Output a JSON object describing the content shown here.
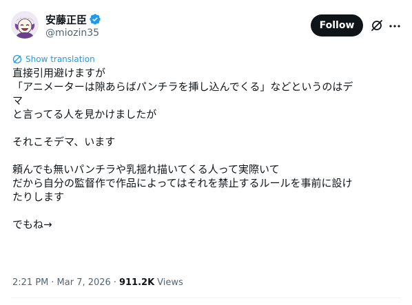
{
  "author": {
    "display_name": "安藤正臣",
    "handle": "@miozin35",
    "verified": true
  },
  "header": {
    "follow_label": "Follow",
    "grok_icon": "grok-icon",
    "more_icon": "more-icon"
  },
  "translate": {
    "label": "Show translation",
    "icon": "translate-icon"
  },
  "body": {
    "line_1": "直接引用避けますが",
    "line_2": "「アニメーターは隙あらばパンチラを挿し込んでくる」などというのはデ",
    "line_3": "マ",
    "line_4": "と言ってる人を見かけましたが",
    "line_5": "それこそデマ、います",
    "line_6": "頼んでも無いパンチラや乳揺れ描いてくる人って実際いて",
    "line_7": "だから自分の監督作で作品によってはそれを禁止するルールを事前に設け",
    "line_8": "たりします",
    "line_9": "でもね→"
  },
  "meta": {
    "time": "2:21 PM",
    "date": "Mar 7, 2026",
    "separator": "·",
    "views_count": "911.2K",
    "views_label": "Views"
  },
  "colors": {
    "text": "#0f1419",
    "secondary": "#536471",
    "link": "#1d9bf0",
    "verified": "#1d9bf0",
    "follow_bg": "#0f1419"
  }
}
